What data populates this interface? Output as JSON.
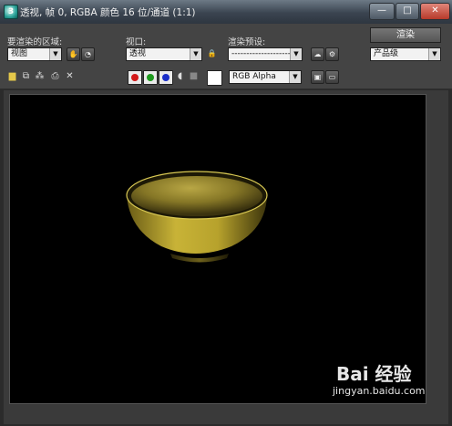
{
  "window": {
    "title": "透视, 帧 0, RGBA 颜色 16 位/通道 (1:1)",
    "app_icon_glyph": "3",
    "buttons": {
      "minimize": "—",
      "maximize": "□",
      "close": "✕"
    }
  },
  "render_area": {
    "label": "要渲染的区域:",
    "value": "视图"
  },
  "viewport": {
    "label": "视口:",
    "value": "透视"
  },
  "preset": {
    "label": "渲染预设:",
    "value": "--------------------"
  },
  "render_button": {
    "label": "渲染"
  },
  "quality": {
    "value": "产品级"
  },
  "toolbar": {
    "channel_swatches": [
      {
        "name": "red-channel",
        "color": "#d21818"
      },
      {
        "name": "green-channel",
        "color": "#1e9a1e"
      },
      {
        "name": "blue-channel",
        "color": "#1a2ec8"
      }
    ],
    "channel_display": {
      "value": "RGB Alpha"
    }
  },
  "watermark": {
    "logo": "Bai 经验",
    "url": "jingyan.baidu.com"
  },
  "icons": [
    "save-icon",
    "copy-icon",
    "clone-icon",
    "print-icon",
    "clear-icon",
    "lock-icon",
    "settings-icon"
  ]
}
